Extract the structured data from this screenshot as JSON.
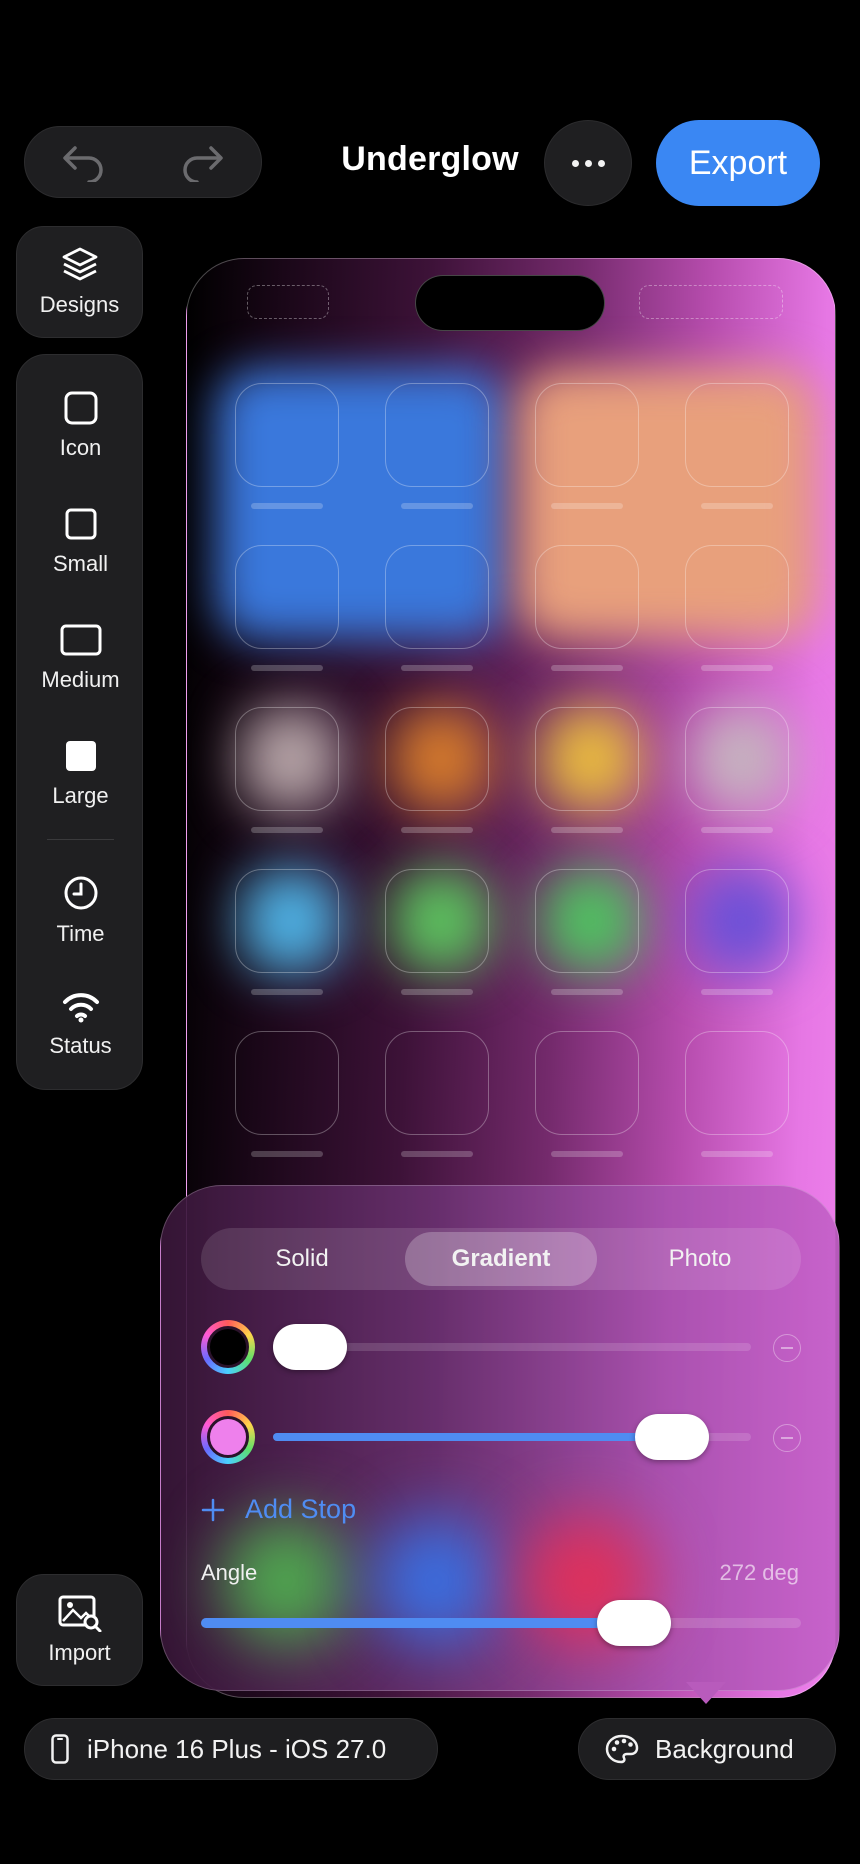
{
  "header": {
    "title": "Underglow",
    "export_label": "Export",
    "undo_icon": "undo-icon",
    "redo_icon": "redo-icon",
    "more_icon": "ellipsis-icon"
  },
  "toolbar": {
    "designs_label": "Designs",
    "items": [
      {
        "label": "Icon",
        "icon": "square-outline-icon"
      },
      {
        "label": "Small",
        "icon": "small-square-icon"
      },
      {
        "label": "Medium",
        "icon": "wide-rectangle-icon"
      },
      {
        "label": "Large",
        "icon": "filled-square-icon"
      },
      {
        "label": "Time",
        "icon": "clock-icon"
      },
      {
        "label": "Status",
        "icon": "wifi-icon"
      }
    ],
    "import_label": "Import"
  },
  "background_editor": {
    "tabs": [
      "Solid",
      "Gradient",
      "Photo"
    ],
    "active_tab": "Gradient",
    "stops": [
      {
        "color": "#000000",
        "position": 0.0
      },
      {
        "color": "#ee80ec",
        "position": 0.81
      }
    ],
    "add_stop_label": "Add Stop",
    "angle_label": "Angle",
    "angle_value": "272 deg",
    "angle_fraction": 0.73,
    "accent_color": "#4f8cf2"
  },
  "footer": {
    "device_label": "iPhone 16 Plus - iOS 27.0",
    "background_label": "Background"
  },
  "colors": {
    "export_button": "#3a87f3",
    "panel": "#1f1f21",
    "background": "#000000"
  }
}
